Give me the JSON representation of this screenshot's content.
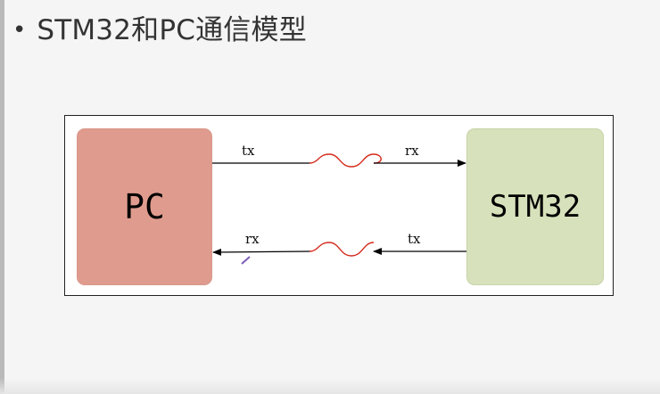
{
  "slide": {
    "bullet": "•",
    "title": "STM32和PC通信模型"
  },
  "diagram": {
    "nodes": {
      "pc": {
        "label": "PC",
        "color": "#df9c8e"
      },
      "stm32": {
        "label": "STM32",
        "color": "#d7e1bb"
      }
    },
    "links": {
      "top": {
        "left_label": "tx",
        "right_label": "rx",
        "direction": "pc-to-stm32"
      },
      "bottom": {
        "left_label": "rx",
        "right_label": "tx",
        "direction": "stm32-to-pc"
      }
    },
    "wave_color": "#d42a1c",
    "line_color": "#000000"
  }
}
